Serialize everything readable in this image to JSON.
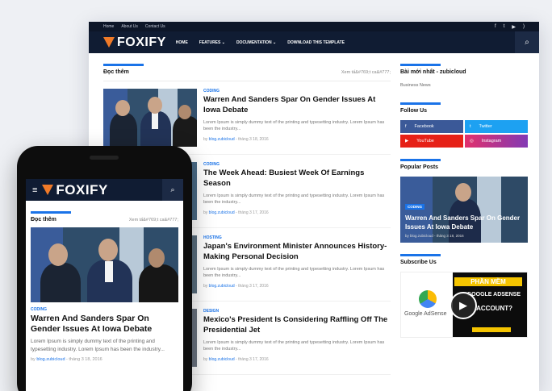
{
  "desktop": {
    "topbar": {
      "links": [
        "Home",
        "About Us",
        "Contact Us"
      ]
    },
    "nav": {
      "logo": "FOXIFY",
      "items": [
        "HOME",
        "FEATURES ⌄",
        "DOCUMENTATION ⌄",
        "DOWNLOAD THIS TEMPLATE"
      ]
    },
    "main": {
      "section_title": "Đọc thêm",
      "see_all": "Xem tấ&#769;t ca&#777;",
      "posts": [
        {
          "label": "CODING",
          "title": "Warren And Sanders Spar On Gender Issues At Iowa Debate",
          "desc": "Lorem Ipsum is simply dummy text of the printing and typesetting industry. Lorem Ipsum has been the industry...",
          "author": "blog.zubicloud",
          "date": "tháng 3 18, 2016"
        },
        {
          "label": "CODING",
          "title": "The Week Ahead: Busiest Week Of Earnings Season",
          "desc": "Lorem Ipsum is simply dummy text of the printing and typesetting industry. Lorem Ipsum has been the industry...",
          "author": "blog.zubicloud",
          "date": "tháng 3 17, 2016"
        },
        {
          "label": "HOSTING",
          "title": "Japan's Environment Minister Announces History-Making Personal Decision",
          "desc": "Lorem Ipsum is simply dummy text of the printing and typesetting industry. Lorem Ipsum has been the industry...",
          "author": "blog.zubicloud",
          "date": "tháng 3 17, 2016"
        },
        {
          "label": "DESIGN",
          "title": "Mexico's President Is Considering Raffling Off The Presidential Jet",
          "desc": "Lorem Ipsum is simply dummy text of the printing and typesetting industry. Lorem Ipsum has been the industry...",
          "author": "blog.zubicloud",
          "date": "tháng 3 17, 2016"
        }
      ]
    },
    "sidebar": {
      "latest_title": "Bài mới nhất - zubicloud",
      "latest_text": "Business News",
      "follow_title": "Follow Us",
      "social": [
        {
          "name": "Facebook",
          "color": "#3b5998"
        },
        {
          "name": "Twitter",
          "color": "#1da1f2"
        },
        {
          "name": "YouTube",
          "color": "#e62117"
        },
        {
          "name": "Instagram",
          "color": "#c13584"
        }
      ],
      "popular_title": "Popular Posts",
      "popular": {
        "label": "CODING",
        "title": "Warren And Sanders Spar On Gender Issues At Iowa Debate",
        "author": "blog.zubicloud",
        "date": "tháng 3 18, 2016"
      },
      "subscribe_title": "Subscribe Us",
      "ad": {
        "headline": "PHẦN MỀM",
        "line2": "GOOGLE ADSENSE",
        "line3": "ACCOUNT?",
        "brand": "Google AdSense"
      }
    }
  },
  "phone": {
    "logo": "FOXIFY",
    "section_title": "Đọc thêm",
    "see_all": "Xem tấ&#769;t ca&#777;",
    "post": {
      "label": "CODING",
      "title": "Warren And Sanders Spar On Gender Issues At Iowa Debate",
      "desc": "Lorem Ipsum is simply dummy text of the printing and typesetting industry. Lorem Ipsum has been the industry...",
      "author": "blog.zubicloud",
      "date": "tháng 3 18, 2016"
    }
  },
  "colors": {
    "nav": "#101c33",
    "accent": "#1a73e8",
    "logo": "#f07a28"
  }
}
